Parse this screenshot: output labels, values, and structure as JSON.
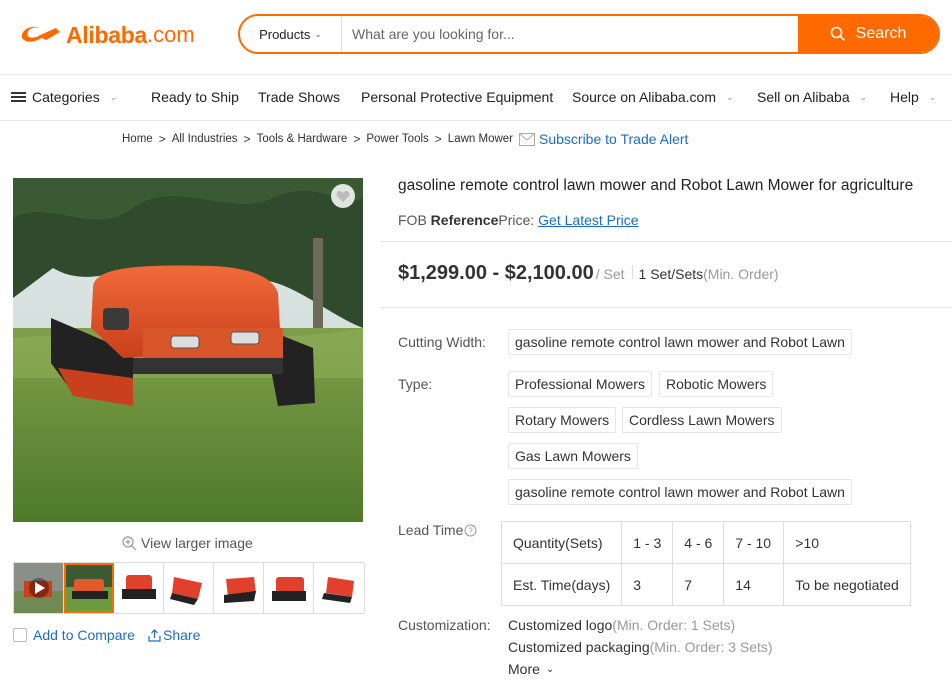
{
  "logo": {
    "word": "Alibaba",
    "domain": ".com"
  },
  "search": {
    "category": "Products",
    "placeholder": "What are you looking for...",
    "button": "Search"
  },
  "nav": {
    "categories": "Categories",
    "items": [
      "Ready to Ship",
      "Trade Shows",
      "Personal Protective Equipment",
      "Source on Alibaba.com",
      "Sell on Alibaba",
      "Help"
    ]
  },
  "breadcrumb": {
    "items": [
      "Home",
      "All Industries",
      "Tools & Hardware",
      "Power Tools",
      "Lawn Mower"
    ],
    "separator": ">",
    "alert": "Subscribe to Trade Alert"
  },
  "gallery": {
    "view_larger": "View larger image",
    "compare": "Add to Compare",
    "share": "Share"
  },
  "product": {
    "title": "gasoline remote control lawn mower and Robot Lawn Mower for agriculture",
    "fob_prefix": "FOB",
    "fob_bold": "Reference",
    "fob_suffix": "Price:",
    "fob_link": "Get Latest Price",
    "price": "$1,299.00 - $2,100.00",
    "price_unit": "/ Set",
    "moq": "1 Set/Sets",
    "moq_label": "(Min. Order)"
  },
  "attributes": {
    "cutting_width_label": "Cutting Width:",
    "cutting_width_value": "gasoline remote control lawn mower and Robot Lawn",
    "type_label": "Type:",
    "types": [
      "Professional Mowers",
      "Robotic Mowers",
      "Rotary Mowers",
      "Cordless Lawn Mowers",
      "Gas Lawn Mowers",
      "gasoline remote control lawn mower and Robot Lawn"
    ]
  },
  "lead_time": {
    "label": "Lead Time",
    "rows": [
      [
        "Quantity(Sets)",
        "1 - 3",
        "4 - 6",
        "7 - 10",
        ">10"
      ],
      [
        "Est. Time(days)",
        "3",
        "7",
        "14",
        "To be negotiated"
      ]
    ]
  },
  "customization": {
    "label": "Customization:",
    "items": [
      {
        "name": "Customized logo",
        "min": "(Min. Order: 1 Sets)"
      },
      {
        "name": "Customized packaging",
        "min": "(Min. Order: 3 Sets)"
      }
    ],
    "more": "More"
  },
  "colors": {
    "brand": "#ff6a00",
    "link": "#1a6cc9"
  }
}
